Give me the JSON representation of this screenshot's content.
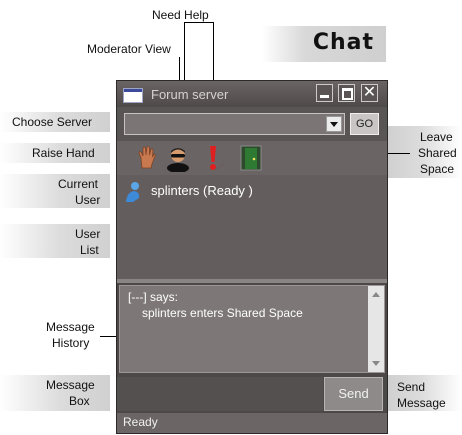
{
  "banner": {
    "title": "Chat"
  },
  "callouts": {
    "need_help": "Need Help",
    "moderator_view": "Moderator View",
    "choose_server": "Choose Server",
    "raise_hand": "Raise Hand",
    "current_user_1": "Current",
    "current_user_2": "User",
    "user_list_1": "User",
    "user_list_2": "List",
    "leave_1": "Leave",
    "leave_2": "Shared",
    "leave_3": "Space",
    "message_history_1": "Message",
    "message_history_2": "History",
    "message_box_1": "Message",
    "message_box_2": "Box",
    "send_message_1": "Send",
    "send_message_2": "Message"
  },
  "window": {
    "title": "Forum server",
    "server_select": {
      "value": ""
    },
    "go_label": "GO",
    "users": [
      {
        "name": "splinters (Ready )"
      }
    ],
    "history": [
      {
        "line": "[---] says:"
      },
      {
        "line": "splinters enters Shared Space"
      }
    ],
    "message_input": {
      "value": ""
    },
    "send_label": "Send",
    "status": "Ready"
  },
  "icons": {
    "raise_hand": "raise-hand-icon",
    "moderator": "moderator-icon",
    "help": "need-help-icon",
    "leave": "leave-door-icon",
    "user": "user-icon"
  },
  "colors": {
    "window_bg": "#4d4848",
    "help_red": "#e02020",
    "door_green": "#2f7a33"
  }
}
